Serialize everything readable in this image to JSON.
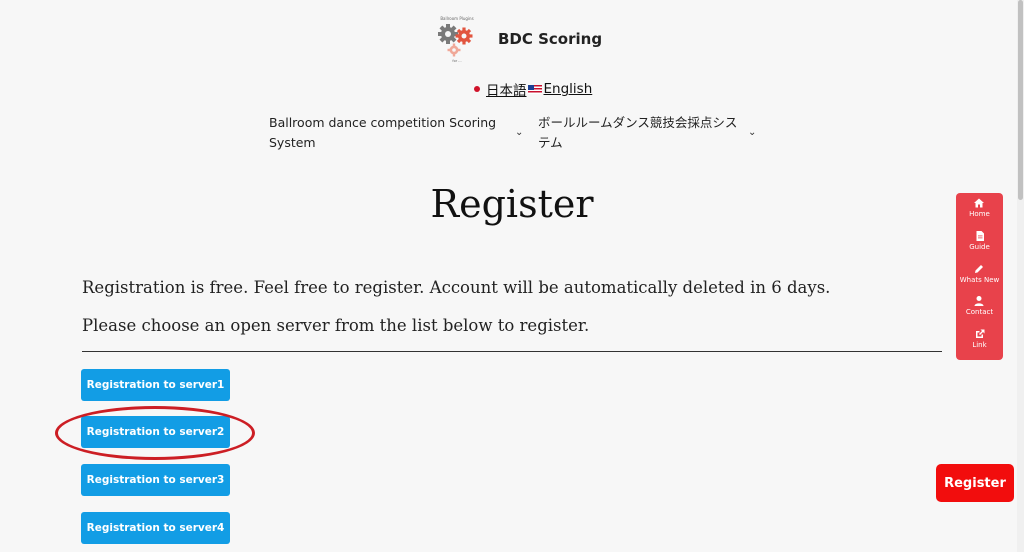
{
  "header": {
    "site_title": "BDC Scoring",
    "logo_text_top": "Ballroom Plugins",
    "logo_text_bottom": "for ...",
    "languages": [
      {
        "label": "日本語"
      },
      {
        "label": "English"
      }
    ]
  },
  "nav": {
    "items": [
      {
        "label": "Ballroom dance competition Scoring System"
      },
      {
        "label": "ボールルームダンス競技会採点システム"
      }
    ]
  },
  "main": {
    "title": "Register",
    "intro_line_1": "Registration is free. Feel free to register. Account will be automatically deleted in 6 days.",
    "intro_line_2": "Please choose an open server from the list below to register.",
    "buttons": [
      {
        "label": "Registration to server1"
      },
      {
        "label": "Registration to server2"
      },
      {
        "label": "Registration to server3"
      },
      {
        "label": "Registration to server4"
      }
    ]
  },
  "side_menu": {
    "items": [
      {
        "label": "Home",
        "icon": "home-icon"
      },
      {
        "label": "Guide",
        "icon": "document-icon"
      },
      {
        "label": "Whats New",
        "icon": "pencil-icon"
      },
      {
        "label": "Contact",
        "icon": "user-icon"
      },
      {
        "label": "Link",
        "icon": "external-link-icon"
      }
    ]
  },
  "floating": {
    "register_label": "Register"
  },
  "colors": {
    "button_blue": "#129de5",
    "side_menu_red": "#e8424b",
    "register_red": "#f20d0d",
    "highlight_red": "#cc1e24",
    "background": "#f7f7f7"
  }
}
